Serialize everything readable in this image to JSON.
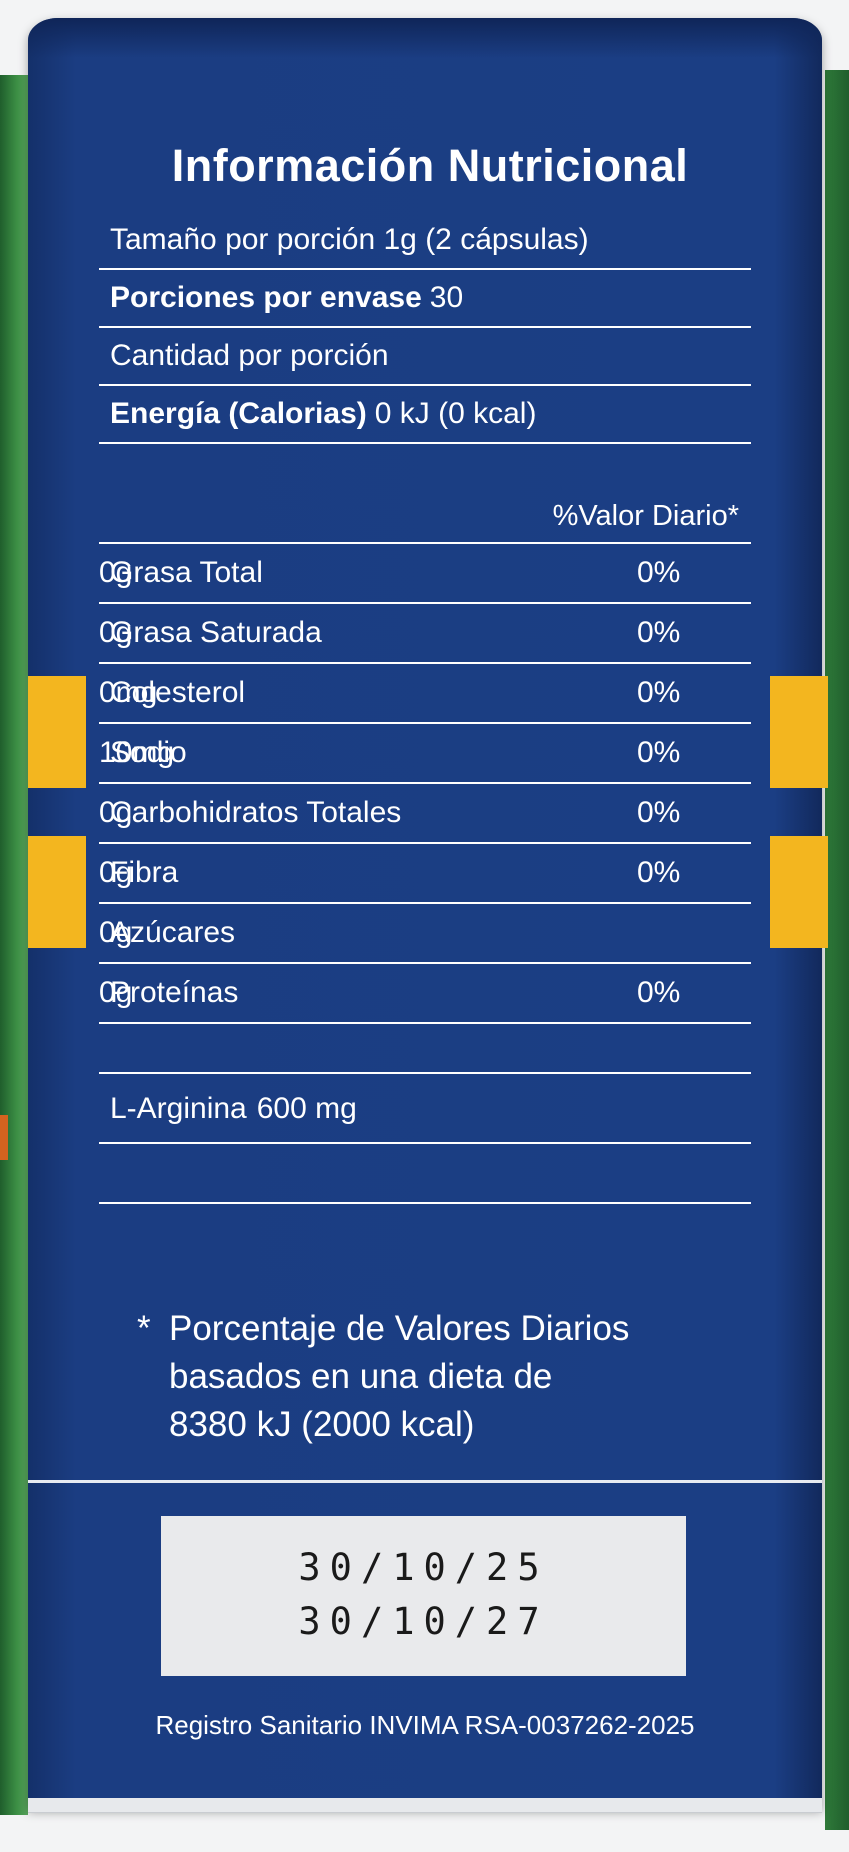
{
  "title": "Información Nutricional",
  "serving_size": "Tamaño por porción 1g (2 cápsulas)",
  "servings_per_container": {
    "label": "Porciones por envase",
    "value": "30"
  },
  "amount_per_serving": "Cantidad por porción",
  "energy": {
    "label": "Energía (Calorias)",
    "value": "0 kJ (0 kcal)"
  },
  "daily_value_header": "%Valor Diario*",
  "nutrients": [
    {
      "name": "Grasa Total",
      "amount": "0g",
      "dv": "0%"
    },
    {
      "name": "Grasa Saturada",
      "amount": "0g",
      "dv": "0%"
    },
    {
      "name": "Colesterol",
      "amount": "0mg",
      "dv": "0%"
    },
    {
      "name": "Sodio",
      "amount": "10mg",
      "dv": "0%"
    },
    {
      "name": "Carbohidratos Totales",
      "amount": "0g",
      "dv": "0%"
    },
    {
      "name": "Fibra",
      "amount": "0g",
      "dv": "0%"
    },
    {
      "name": "Azúcares",
      "amount": "0g",
      "dv": ""
    },
    {
      "name": "Proteínas",
      "amount": "0g",
      "dv": "0%"
    }
  ],
  "arginine": {
    "label": "L-Arginina",
    "value": "600 mg"
  },
  "footnote": {
    "star": "*",
    "lines": [
      "Porcentaje de Valores Diarios",
      "basados en una dieta de",
      "8380 kJ (2000 kcal)"
    ]
  },
  "dates": [
    "30/10/25",
    "30/10/27"
  ],
  "registro": "Registro Sanitario INVIMA RSA-0037262-2025",
  "colors": {
    "box_blue": "#1b3e84",
    "accent_yellow": "#f3b61f",
    "text_white": "#ffffff",
    "date_box": "#e9eaec"
  }
}
